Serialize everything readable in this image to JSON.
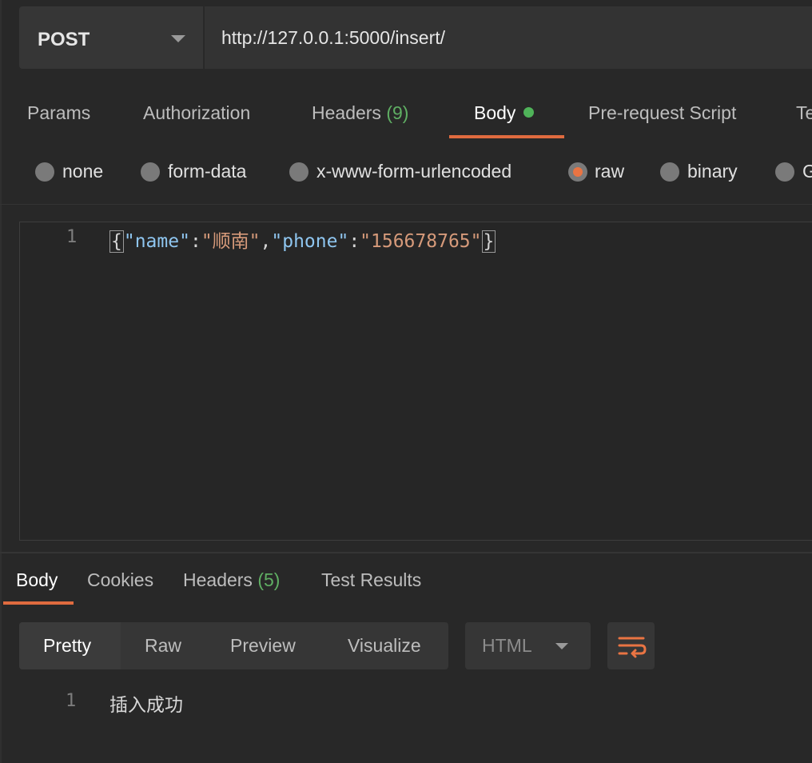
{
  "request": {
    "method": "POST",
    "url": "http://127.0.0.1:5000/insert/"
  },
  "request_tabs": {
    "params": "Params",
    "authorization": "Authorization",
    "headers": "Headers",
    "headers_count": "(9)",
    "body": "Body",
    "pre_request": "Pre-request Script",
    "tests_partial": "Te"
  },
  "body_types": {
    "none": "none",
    "form_data": "form-data",
    "urlencoded": "x-www-form-urlencoded",
    "raw": "raw",
    "binary": "binary",
    "graphql_partial": "G",
    "selected": "raw"
  },
  "editor": {
    "line_number": "1",
    "open_brace": "{",
    "key1": "\"name\"",
    "colon": ":",
    "val1": "\"顺南\"",
    "comma": ",",
    "key2": "\"phone\"",
    "val2": "\"156678765\"",
    "close_brace": "}"
  },
  "response_tabs": {
    "body": "Body",
    "cookies": "Cookies",
    "headers": "Headers",
    "headers_count": "(5)",
    "test_results": "Test Results"
  },
  "response_view": {
    "pretty": "Pretty",
    "raw": "Raw",
    "preview": "Preview",
    "visualize": "Visualize",
    "format": "HTML",
    "wrap_icon": "wrap-lines-icon"
  },
  "response": {
    "line_number": "1",
    "text": "插入成功"
  },
  "colors": {
    "accent": "#e06b3f",
    "count_green": "#5fae63",
    "json_key": "#8fc6f0",
    "json_string": "#d69a7a"
  }
}
